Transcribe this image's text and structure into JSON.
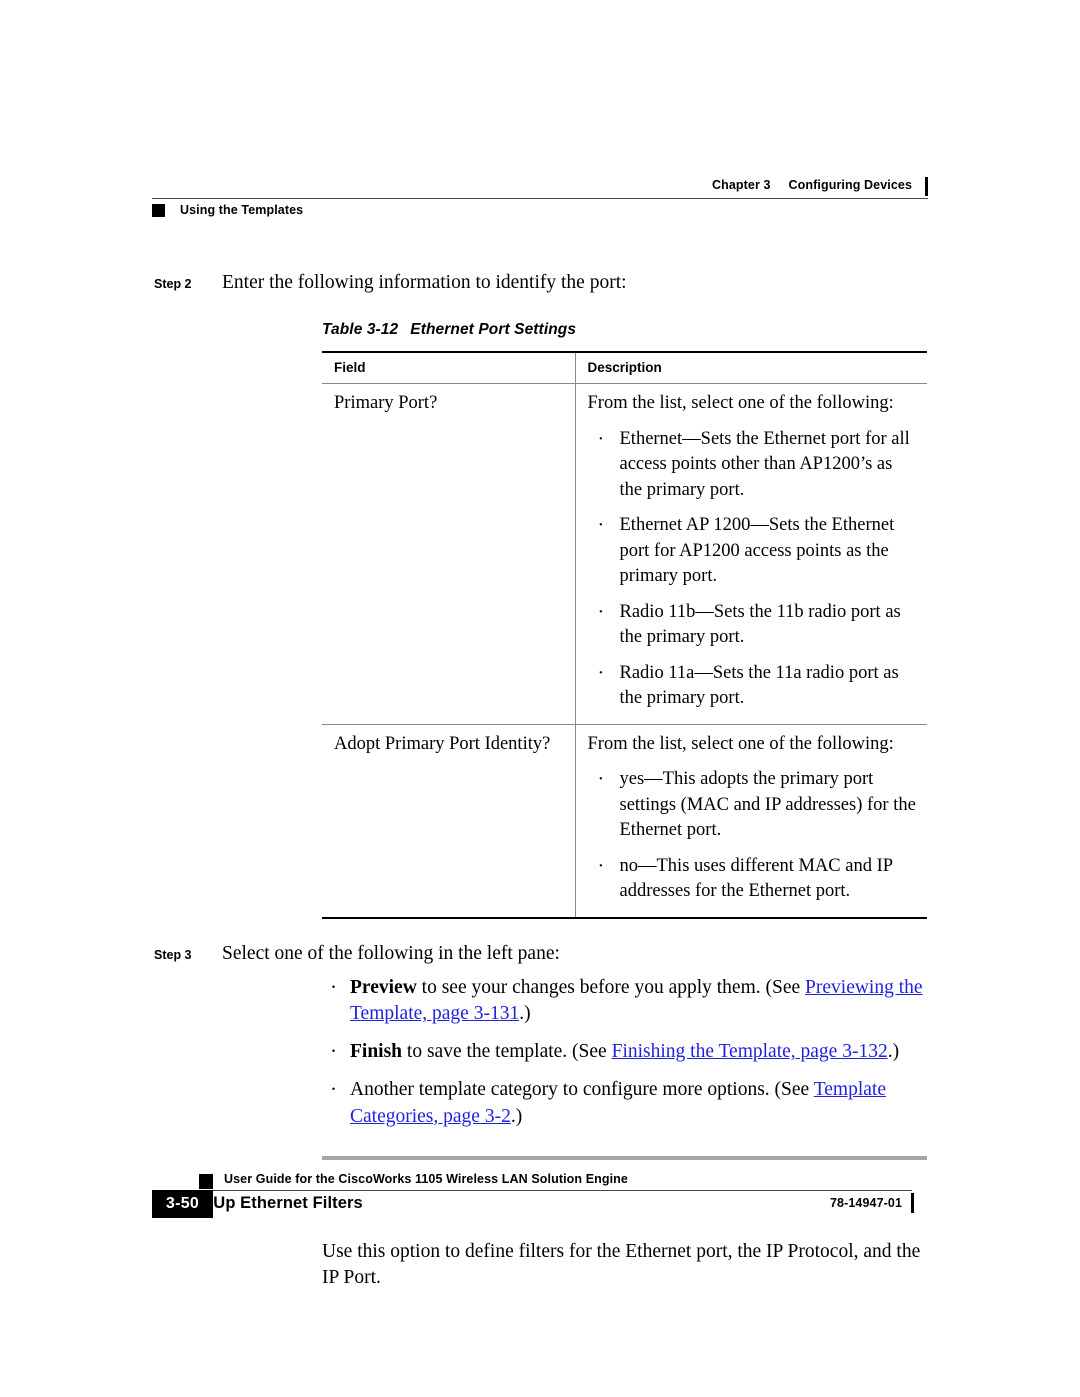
{
  "header": {
    "chapter_label": "Chapter 3",
    "chapter_title": "Configuring Devices",
    "running_head": "Using the Templates"
  },
  "steps": [
    {
      "label": "Step 2",
      "text": "Enter the following information to identify the port:"
    },
    {
      "label": "Step 3",
      "text": "Select one of the following in the left pane:"
    }
  ],
  "table": {
    "caption_number": "Table 3-12",
    "caption_title": "Ethernet Port Settings",
    "columns": [
      "Field",
      "Description"
    ],
    "rows": [
      {
        "field": "Primary Port?",
        "lead": "From the list, select one of the following:",
        "items": [
          "Ethernet—Sets the Ethernet port for all access points other than AP1200’s as the primary port.",
          "Ethernet AP 1200—Sets the Ethernet port for AP1200 access points as the primary port.",
          "Radio 11b—Sets the 11b radio port as the primary port.",
          "Radio 11a—Sets the 11a radio port as the primary port."
        ]
      },
      {
        "field": "Adopt Primary Port Identity?",
        "lead": "From the list, select one of the following:",
        "items": [
          "yes—This adopts the primary port settings (MAC and IP addresses) for the Ethernet port.",
          "no—This uses different MAC and IP addresses for the Ethernet port."
        ]
      }
    ]
  },
  "step3_bullets": [
    {
      "bold_lead": "Preview",
      "text_before_link": " to see your changes before you apply them. (See ",
      "link": "Previewing the Template, page 3-131",
      "text_after_link": ".)"
    },
    {
      "bold_lead": "Finish",
      "text_before_link": " to save the template. (See ",
      "link": "Finishing the Template, page 3-132",
      "text_after_link": ".)"
    },
    {
      "bold_lead": "",
      "text_before_link": "Another template category to configure more options. (See ",
      "link": "Template Categories, page 3-2",
      "text_after_link": ".)"
    }
  ],
  "section": {
    "heading": "Setting Up Ethernet Filters",
    "paragraph": "Use this option to define filters for the Ethernet port, the IP Protocol, and the IP Port."
  },
  "footer": {
    "doc_title": "User Guide for the CiscoWorks 1105 Wireless LAN Solution Engine",
    "page_number": "3-50",
    "doc_id": "78-14947-01"
  },
  "colors": {
    "link": "#2222dd",
    "rule_gray": "#a6a6a6",
    "table_rule": "#8a8a8a",
    "ink": "#000000"
  }
}
